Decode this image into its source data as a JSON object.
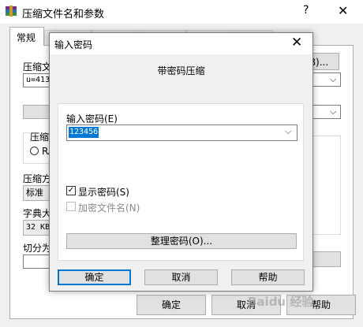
{
  "background": {
    "title": "压缩文件名和参数",
    "help_glyph": "?",
    "close_glyph": "✕",
    "tab_general": "常规",
    "archive_name_label": "压缩文",
    "archive_name_value": "u=4136",
    "browse_button_partial": "B)...",
    "format_label": "压缩",
    "format_rar_label": "RA",
    "method_label": "压缩方",
    "method_value": "标准",
    "dict_label": "字典大",
    "dict_value": "32 KB",
    "split_label": "切分为",
    "ok_button": "确定",
    "cancel_button": "取消",
    "help_button_partial": "帮助"
  },
  "dialog": {
    "title": "输入密码",
    "close_glyph": "✕",
    "heading": "带密码压缩",
    "password_label": "输入密码(E)",
    "password_value": "123456",
    "show_password_label": "显示密码(S)",
    "show_password_checked": true,
    "check_glyph": "✓",
    "encrypt_filenames_label": "加密文件名(N)",
    "encrypt_filenames_checked": false,
    "organize_button": "整理密码(O)...",
    "ok_button": "确定",
    "cancel_button": "取消",
    "help_button": "帮助",
    "dropdown_glyph": "⌵"
  },
  "watermark": "Baidu 经验",
  "colors": {
    "selection": "#0078d7",
    "default_button_border": "#0078d7",
    "dialog_bg": "#f0f0f0"
  }
}
